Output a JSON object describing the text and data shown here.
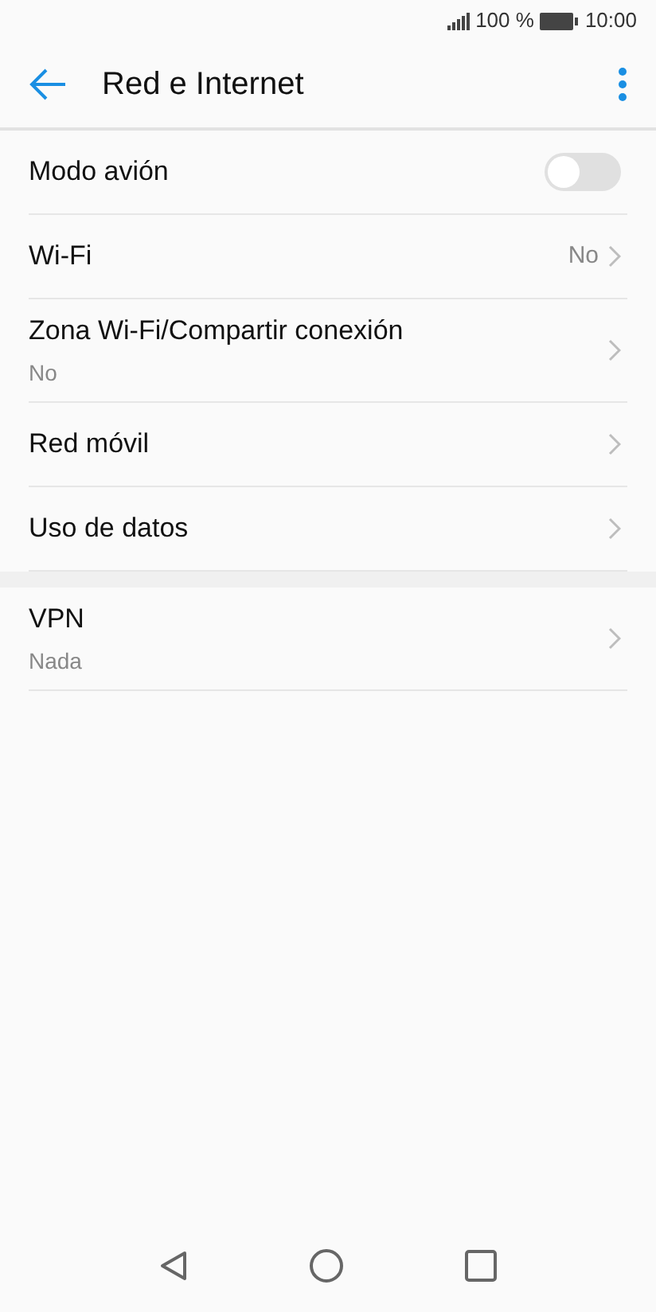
{
  "status_bar": {
    "battery": "100 %",
    "time": "10:00"
  },
  "app_bar": {
    "title": "Red e Internet"
  },
  "sections": [
    {
      "items": [
        {
          "kind": "toggle",
          "label": "Modo avión",
          "on": false
        },
        {
          "kind": "value",
          "label": "Wi-Fi",
          "value": "No"
        },
        {
          "kind": "link",
          "label": "Zona Wi-Fi/Compartir conexión",
          "subtitle": "No"
        },
        {
          "kind": "link",
          "label": "Red móvil"
        },
        {
          "kind": "link",
          "label": "Uso de datos"
        }
      ]
    },
    {
      "items": [
        {
          "kind": "link",
          "label": "VPN",
          "subtitle": "Nada"
        }
      ]
    }
  ]
}
